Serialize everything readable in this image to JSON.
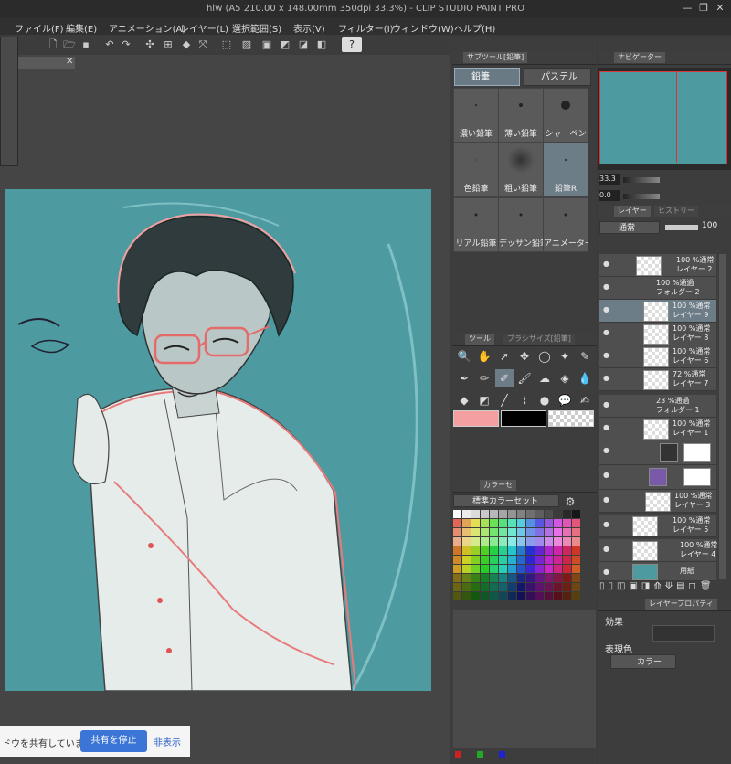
{
  "app": {
    "title": "hlw (A5 210.00 x 148.00mm 350dpi 33.3%) - CLIP STUDIO PAINT PRO",
    "min": "—",
    "max": "❐",
    "close": "✕"
  },
  "menu": [
    "ファイル(F)",
    "編集(E)",
    "アニメーション(A)",
    "レイヤー(L)",
    "選択範囲(S)",
    "表示(V)",
    "フィルター(I)",
    "ウィンドウ(W)",
    "ヘルプ(H)"
  ],
  "doc_tab": {
    "close": "✕"
  },
  "subtool": {
    "tab_label": "サブツール[鉛筆]",
    "groups": [
      "鉛筆",
      "パステル"
    ],
    "brushes": [
      "濃い鉛筆",
      "薄い鉛筆",
      "シャーペン",
      "色鉛筆",
      "粗い鉛筆",
      "鉛筆R",
      "リアル鉛筆",
      "デッサン鉛筆",
      "アニメーター"
    ]
  },
  "tool_panel": {
    "tab1": "ツール",
    "tab2": "ブラシサイズ[鉛筆]"
  },
  "color": {
    "tab": "カラーセ",
    "palette_name": "標準カラーセット",
    "main_color": "#f4a0a0",
    "sub_color": "#000000"
  },
  "navigator": {
    "tab1": "ナビゲーター",
    "zoom": "33.3",
    "angle": "0.0"
  },
  "layers": {
    "tab1": "レイヤー",
    "tab2": "ヒストリー",
    "blend_mode": "通常",
    "opacity": "100",
    "items": [
      {
        "pct": "100 %通常",
        "name": "レイヤー 2"
      },
      {
        "pct": "100 %通過",
        "name": "フォルダー 2"
      },
      {
        "pct": "100 %通常",
        "name": "レイヤー 9"
      },
      {
        "pct": "100 %通常",
        "name": "レイヤー 8"
      },
      {
        "pct": "100 %通常",
        "name": "レイヤー 6"
      },
      {
        "pct": "72 %通常",
        "name": "レイヤー 7"
      },
      {
        "pct": "23 %通過",
        "name": "フォルダー 1"
      },
      {
        "pct": "100 %通常",
        "name": "レイヤー 1"
      },
      {
        "pct": "100 %通常",
        "name": "レイヤー 3"
      },
      {
        "pct": "100 %通常",
        "name": "レイヤー 5"
      },
      {
        "pct": "100 %通常",
        "name": "レイヤー 4"
      },
      {
        "pct": "",
        "name": "用紙"
      }
    ]
  },
  "layer_property": {
    "tab": "レイヤープロパティ",
    "effect": "効果",
    "display_color": "表現色",
    "color_mode": "カラー"
  },
  "share": {
    "text": "ドウを共有しています。",
    "stop": "共有を停止",
    "hide": "非表示"
  }
}
